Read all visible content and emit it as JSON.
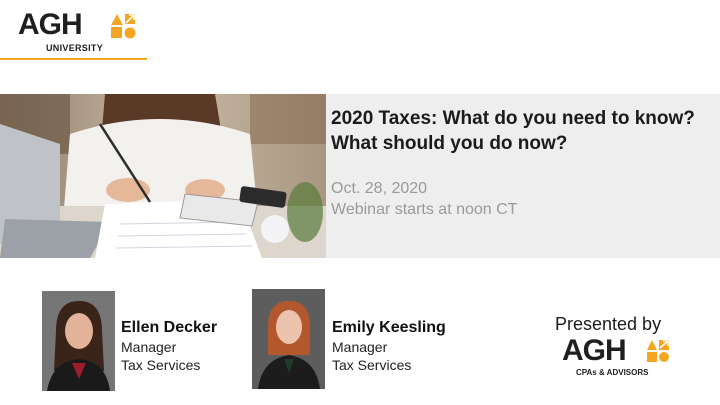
{
  "logo": {
    "mark": "AGH",
    "sub": "UNIVERSITY",
    "accent_color": "#f4a623"
  },
  "hero": {
    "title": "2020 Taxes: What do you need to know? What should you do now?",
    "date": "Oct. 28, 2020",
    "starts": "Webinar starts at noon CT"
  },
  "speakers": [
    {
      "name": "Ellen Decker",
      "role": "Manager",
      "dept": "Tax Services"
    },
    {
      "name": "Emily Keesling",
      "role": "Manager",
      "dept": "Tax Services"
    }
  ],
  "presented": {
    "label": "Presented by",
    "mark": "AGH",
    "tagline": "CPAs & ADVISORS"
  }
}
